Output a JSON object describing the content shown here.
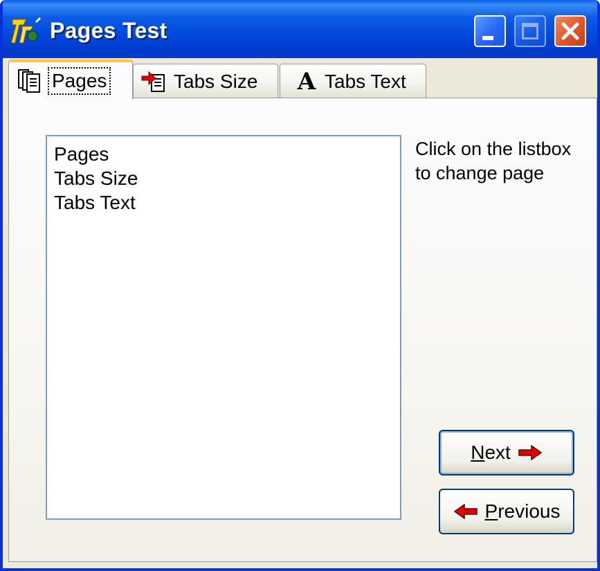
{
  "window": {
    "title": "Pages Test"
  },
  "tabs": [
    {
      "label": "Pages",
      "icon": "pages-icon",
      "selected": true
    },
    {
      "label": "Tabs Size",
      "icon": "tabs-size-icon",
      "selected": false
    },
    {
      "label": "Tabs Text",
      "icon": "font-a-icon",
      "selected": false,
      "icon_glyph": "A"
    }
  ],
  "listbox": {
    "items": [
      "Pages",
      "Tabs Size",
      "Tabs Text"
    ]
  },
  "hint": {
    "line1": "Click on the listbox",
    "line2": "to change page"
  },
  "buttons": {
    "next": {
      "mnemonic": "N",
      "rest": "ext"
    },
    "previous": {
      "mnemonic": "P",
      "rest": "revious"
    }
  },
  "colors": {
    "titlebar": "#0043d9",
    "close": "#e25a2c",
    "arrow": "#e00000",
    "selected_tab_accent": "#ffc83c"
  }
}
